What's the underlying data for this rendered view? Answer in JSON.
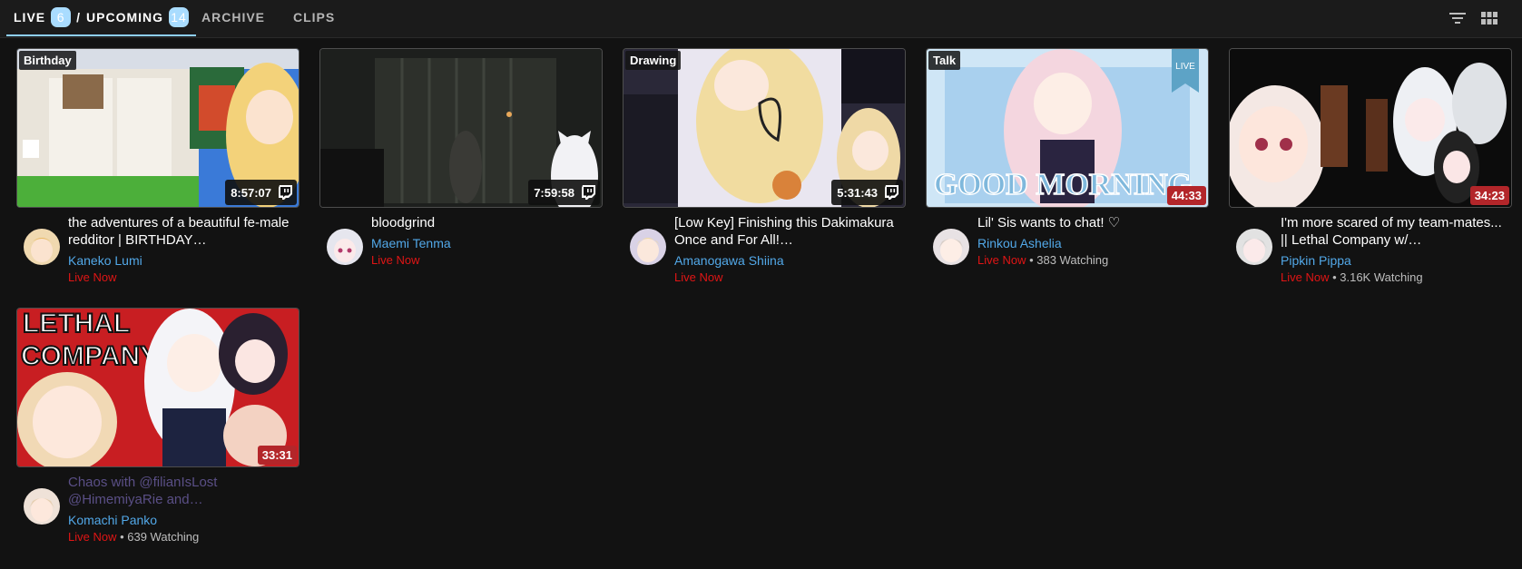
{
  "tabs": {
    "live_label": "LIVE",
    "live_count": "6",
    "separator": "/",
    "upcoming_label": "UPCOMING",
    "upcoming_count": "14",
    "archive_label": "ARCHIVE",
    "clips_label": "CLIPS"
  },
  "toolbar": {
    "filter_icon": "filter-icon",
    "grid_icon": "grid-view-icon"
  },
  "colors": {
    "accent": "#8fd0ff",
    "live_red": "#e01515",
    "channel_blue": "#52a8e8",
    "background": "#121212"
  },
  "videos": [
    {
      "topic": "Birthday",
      "duration": "8:57:07",
      "platform_icon": "twitch-icon",
      "title": "the adventures of a beautiful fe-male redditor | BIRTHDAY…",
      "channel": "Kaneko Lumi",
      "status": "Live Now",
      "watching": ""
    },
    {
      "topic": "",
      "duration": "7:59:58",
      "platform_icon": "twitch-icon",
      "title": "bloodgrind",
      "channel": "Maemi Tenma",
      "status": "Live Now",
      "watching": ""
    },
    {
      "topic": "Drawing",
      "duration": "5:31:43",
      "platform_icon": "twitch-icon",
      "title": "[Low Key] Finishing this Dakimakura Once and For All!…",
      "channel": "Amanogawa Shiina",
      "status": "Live Now",
      "watching": ""
    },
    {
      "topic": "Talk",
      "duration": "44:33",
      "platform_icon": "",
      "title": "Lil' Sis wants to chat! ♡",
      "channel": "Rinkou Ashelia",
      "status": "Live Now",
      "watching": "• 383 Watching"
    },
    {
      "topic": "",
      "duration": "34:23",
      "platform_icon": "",
      "title": "I'm more scared of my team-mates... || Lethal Company w/…",
      "channel": "Pipkin Pippa",
      "status": "Live Now",
      "watching": "• 3.16K Watching"
    },
    {
      "topic": "",
      "duration": "33:31",
      "platform_icon": "",
      "title": "Chaos with @filianIsLost @HimemiyaRie and…",
      "channel": "Komachi Panko",
      "status": "Live Now",
      "watching": "• 639 Watching"
    }
  ],
  "thumbnail_text": {
    "good_morning": "GOOD MORNING",
    "live_ribbon": "LIVE",
    "lethal": "LETHAL",
    "company": "COMPANY"
  }
}
